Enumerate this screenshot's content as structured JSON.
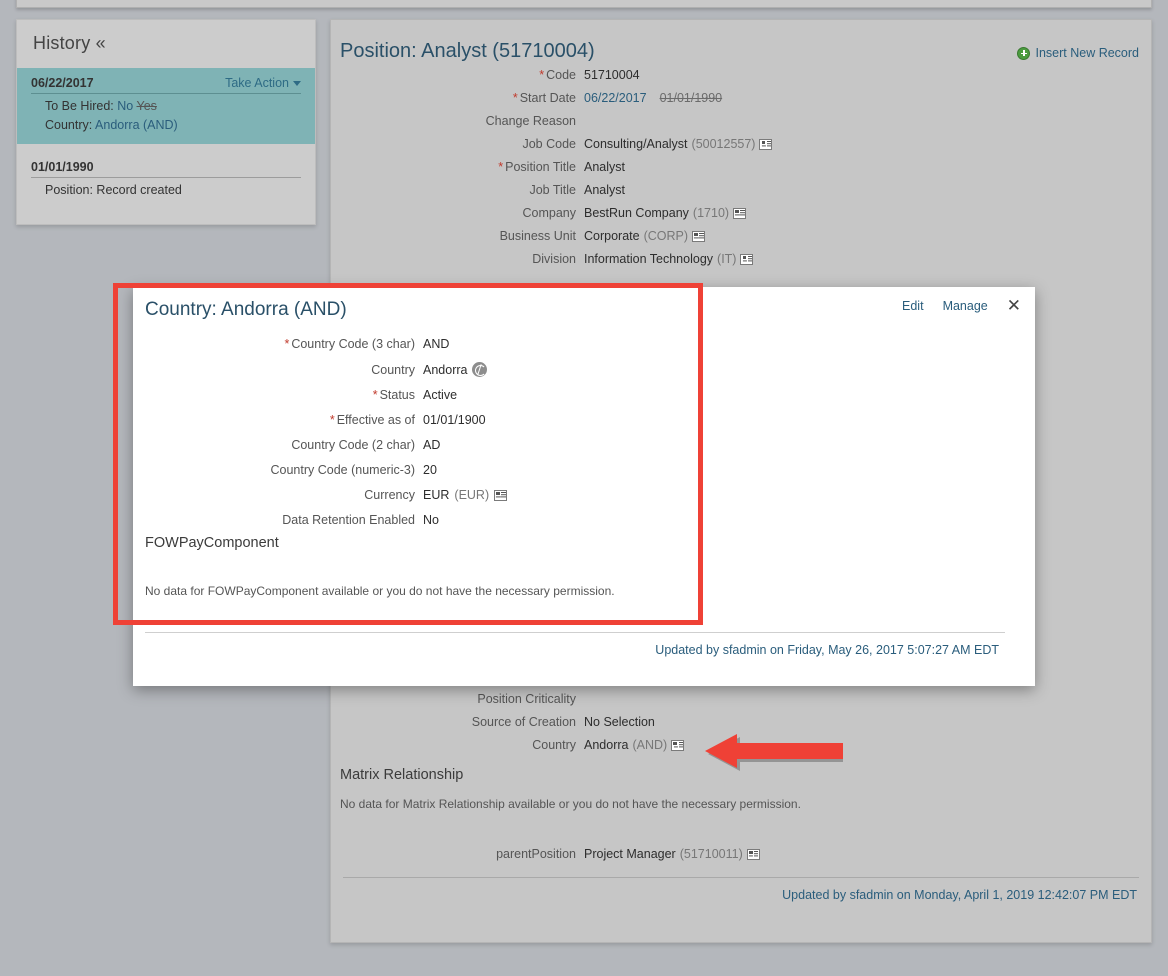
{
  "history": {
    "title": "History «",
    "entries": [
      {
        "date": "06/22/2017",
        "action_label": "Take Action",
        "lines": [
          {
            "label": "To Be Hired:",
            "value": "No",
            "old_value": "Yes"
          },
          {
            "label": "Country:",
            "value": "Andorra (AND)",
            "old_value": ""
          }
        ]
      },
      {
        "date": "01/01/1990",
        "action_label": "",
        "lines": [
          {
            "label": "Position: Record created",
            "value": "",
            "old_value": ""
          }
        ]
      }
    ]
  },
  "position": {
    "title": "Position:  Analyst (51710004)",
    "insert_label": "Insert New Record",
    "insert_icon": "plus-circle-icon",
    "fields": [
      {
        "label": "Code",
        "required": true,
        "value": "51710004"
      },
      {
        "label": "Start Date",
        "required": true,
        "value": "06/22/2017",
        "old_value": "01/01/1990"
      },
      {
        "label": "Change Reason",
        "required": false,
        "value": ""
      },
      {
        "label": "Job Code",
        "required": false,
        "value": "Consulting/Analyst",
        "code": "(50012557)",
        "lookup": true
      },
      {
        "label": "Position Title",
        "required": true,
        "value": "Analyst"
      },
      {
        "label": "Job Title",
        "required": false,
        "value": "Analyst"
      },
      {
        "label": "Company",
        "required": false,
        "value": "BestRun Company",
        "code": "(1710)",
        "lookup": true
      },
      {
        "label": "Business Unit",
        "required": false,
        "value": "Corporate",
        "code": "(CORP)",
        "lookup": true
      },
      {
        "label": "Division",
        "required": false,
        "value": "Information Technology",
        "code": "(IT)",
        "lookup": true
      }
    ],
    "lower_fields": [
      {
        "label": "Position Criticality",
        "required": false,
        "value": ""
      },
      {
        "label": "Source of Creation",
        "required": false,
        "value": "No Selection"
      },
      {
        "label": "Country",
        "required": false,
        "value": "Andorra",
        "code": "(AND)",
        "lookup": true
      }
    ],
    "matrix_section_title": "Matrix Relationship",
    "matrix_note": "No data for Matrix Relationship available or you do not have the necessary permission.",
    "parent_field": {
      "label": "parentPosition",
      "value": "Project Manager",
      "code": "(51710011)",
      "lookup": true
    },
    "footer": "Updated by sfadmin on Monday, April 1, 2019 12:42:07 PM EDT"
  },
  "popup": {
    "title": "Country: Andorra (AND)",
    "edit_label": "Edit",
    "manage_label": "Manage",
    "close_icon": "close-icon",
    "fields": [
      {
        "label": "Country Code (3 char)",
        "required": true,
        "value": "AND"
      },
      {
        "label": "Country",
        "required": false,
        "value": "Andorra",
        "globe": true
      },
      {
        "label": "Status",
        "required": true,
        "value": "Active"
      },
      {
        "label": "Effective as of",
        "required": true,
        "value": "01/01/1900"
      },
      {
        "label": "Country Code (2 char)",
        "required": false,
        "value": "AD"
      },
      {
        "label": "Country Code (numeric-3)",
        "required": false,
        "value": "20"
      },
      {
        "label": "Currency",
        "required": false,
        "value": "EUR",
        "code": "(EUR)",
        "lookup": true
      },
      {
        "label": "Data Retention Enabled",
        "required": false,
        "value": "No"
      }
    ],
    "subsection_title": "FOWPayComponent",
    "subsection_note": "No data for FOWPayComponent available or you do not have the necessary permission.",
    "footer": "Updated by sfadmin on Friday, May 26, 2017 5:07:27 AM EDT"
  },
  "annotations": {
    "highlight_color": "#ef4136",
    "arrow_color": "#ef4136",
    "arrow_direction": "left"
  },
  "colors": {
    "page_bg": "#b4b7bc",
    "panel_bg": "#c6c6c6",
    "history_bg": "#cccccc",
    "history_active": "#7fb3b5",
    "link": "#2a5d7c",
    "title": "#2a5068",
    "required": "#c0392b"
  }
}
